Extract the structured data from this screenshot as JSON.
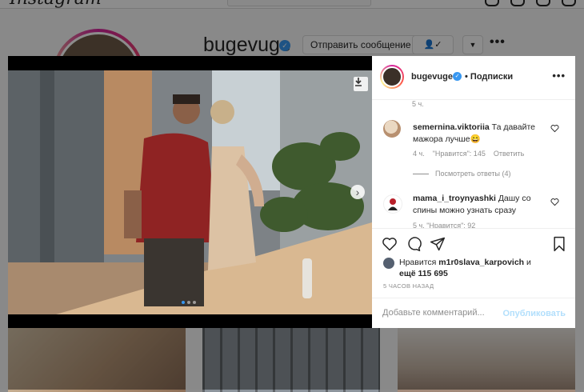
{
  "background_page": {
    "logo": "Instagram",
    "username": "bugevuge",
    "message_button": "Отправить сообщение",
    "follow_icon": "person-check-icon",
    "dropdown_icon": "chevron-down-icon",
    "more_icon": "more-horizontal-icon"
  },
  "post": {
    "carousel": {
      "slide_count": 3,
      "active_slide": 1
    },
    "header": {
      "username": "bugevuge",
      "follow_label": "• Подписки",
      "more_icon": "more-horizontal-icon"
    },
    "comments": [
      {
        "top_time": "5 ч."
      },
      {
        "username": "semernina.viktoriia",
        "text": "Та давайте мажора лучше😄",
        "time": "4 ч.",
        "likes": "\"Нравится\": 145",
        "reply": "Ответить",
        "view_replies": "Посмотреть ответы (4)"
      },
      {
        "username": "mama_i_troynyashki",
        "text": "Дашу со спины можно узнать сразу",
        "meta_partial": "5 ч.   \"Нравится\": 92"
      }
    ],
    "actions": [
      "heart-icon",
      "comment-icon",
      "share-icon",
      "bookmark-icon"
    ],
    "likes": {
      "prefix": "Нравится",
      "user": "m1r0slava_karpovich",
      "suffix": "и",
      "rest": "ещё 115 695"
    },
    "timestamp": "5 ЧАСОВ НАЗАД",
    "add_comment": {
      "placeholder": "Добавьте комментарий...",
      "post_label": "Опубликовать"
    }
  },
  "colors": {
    "accent_blue": "#3897f0",
    "post_disabled": "#b2dffc",
    "muted_text": "#8e8e8e"
  }
}
